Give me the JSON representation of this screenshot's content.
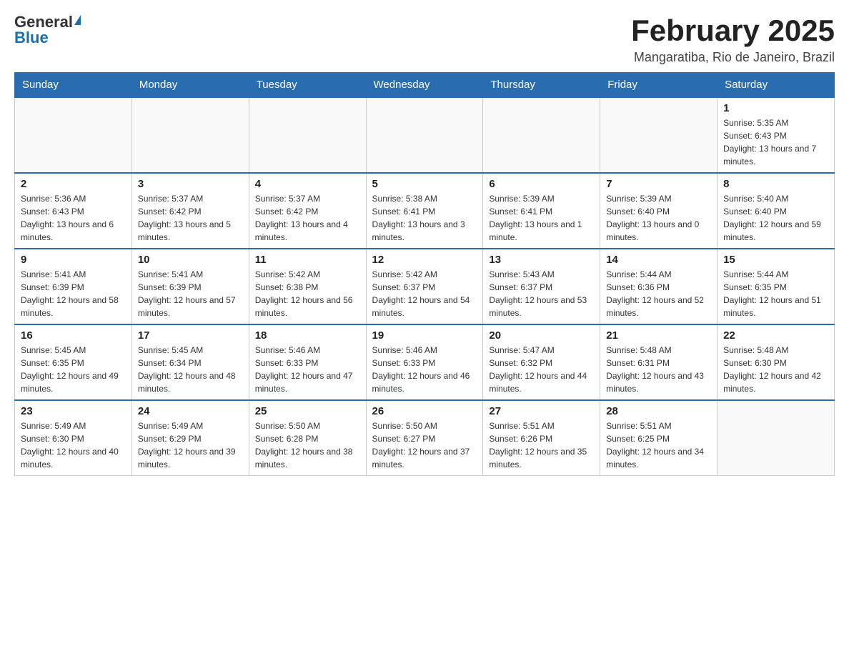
{
  "header": {
    "logo": {
      "general": "General",
      "blue": "Blue"
    },
    "title": "February 2025",
    "location": "Mangaratiba, Rio de Janeiro, Brazil"
  },
  "weekdays": [
    "Sunday",
    "Monday",
    "Tuesday",
    "Wednesday",
    "Thursday",
    "Friday",
    "Saturday"
  ],
  "weeks": [
    [
      {
        "day": "",
        "info": ""
      },
      {
        "day": "",
        "info": ""
      },
      {
        "day": "",
        "info": ""
      },
      {
        "day": "",
        "info": ""
      },
      {
        "day": "",
        "info": ""
      },
      {
        "day": "",
        "info": ""
      },
      {
        "day": "1",
        "info": "Sunrise: 5:35 AM\nSunset: 6:43 PM\nDaylight: 13 hours and 7 minutes."
      }
    ],
    [
      {
        "day": "2",
        "info": "Sunrise: 5:36 AM\nSunset: 6:43 PM\nDaylight: 13 hours and 6 minutes."
      },
      {
        "day": "3",
        "info": "Sunrise: 5:37 AM\nSunset: 6:42 PM\nDaylight: 13 hours and 5 minutes."
      },
      {
        "day": "4",
        "info": "Sunrise: 5:37 AM\nSunset: 6:42 PM\nDaylight: 13 hours and 4 minutes."
      },
      {
        "day": "5",
        "info": "Sunrise: 5:38 AM\nSunset: 6:41 PM\nDaylight: 13 hours and 3 minutes."
      },
      {
        "day": "6",
        "info": "Sunrise: 5:39 AM\nSunset: 6:41 PM\nDaylight: 13 hours and 1 minute."
      },
      {
        "day": "7",
        "info": "Sunrise: 5:39 AM\nSunset: 6:40 PM\nDaylight: 13 hours and 0 minutes."
      },
      {
        "day": "8",
        "info": "Sunrise: 5:40 AM\nSunset: 6:40 PM\nDaylight: 12 hours and 59 minutes."
      }
    ],
    [
      {
        "day": "9",
        "info": "Sunrise: 5:41 AM\nSunset: 6:39 PM\nDaylight: 12 hours and 58 minutes."
      },
      {
        "day": "10",
        "info": "Sunrise: 5:41 AM\nSunset: 6:39 PM\nDaylight: 12 hours and 57 minutes."
      },
      {
        "day": "11",
        "info": "Sunrise: 5:42 AM\nSunset: 6:38 PM\nDaylight: 12 hours and 56 minutes."
      },
      {
        "day": "12",
        "info": "Sunrise: 5:42 AM\nSunset: 6:37 PM\nDaylight: 12 hours and 54 minutes."
      },
      {
        "day": "13",
        "info": "Sunrise: 5:43 AM\nSunset: 6:37 PM\nDaylight: 12 hours and 53 minutes."
      },
      {
        "day": "14",
        "info": "Sunrise: 5:44 AM\nSunset: 6:36 PM\nDaylight: 12 hours and 52 minutes."
      },
      {
        "day": "15",
        "info": "Sunrise: 5:44 AM\nSunset: 6:35 PM\nDaylight: 12 hours and 51 minutes."
      }
    ],
    [
      {
        "day": "16",
        "info": "Sunrise: 5:45 AM\nSunset: 6:35 PM\nDaylight: 12 hours and 49 minutes."
      },
      {
        "day": "17",
        "info": "Sunrise: 5:45 AM\nSunset: 6:34 PM\nDaylight: 12 hours and 48 minutes."
      },
      {
        "day": "18",
        "info": "Sunrise: 5:46 AM\nSunset: 6:33 PM\nDaylight: 12 hours and 47 minutes."
      },
      {
        "day": "19",
        "info": "Sunrise: 5:46 AM\nSunset: 6:33 PM\nDaylight: 12 hours and 46 minutes."
      },
      {
        "day": "20",
        "info": "Sunrise: 5:47 AM\nSunset: 6:32 PM\nDaylight: 12 hours and 44 minutes."
      },
      {
        "day": "21",
        "info": "Sunrise: 5:48 AM\nSunset: 6:31 PM\nDaylight: 12 hours and 43 minutes."
      },
      {
        "day": "22",
        "info": "Sunrise: 5:48 AM\nSunset: 6:30 PM\nDaylight: 12 hours and 42 minutes."
      }
    ],
    [
      {
        "day": "23",
        "info": "Sunrise: 5:49 AM\nSunset: 6:30 PM\nDaylight: 12 hours and 40 minutes."
      },
      {
        "day": "24",
        "info": "Sunrise: 5:49 AM\nSunset: 6:29 PM\nDaylight: 12 hours and 39 minutes."
      },
      {
        "day": "25",
        "info": "Sunrise: 5:50 AM\nSunset: 6:28 PM\nDaylight: 12 hours and 38 minutes."
      },
      {
        "day": "26",
        "info": "Sunrise: 5:50 AM\nSunset: 6:27 PM\nDaylight: 12 hours and 37 minutes."
      },
      {
        "day": "27",
        "info": "Sunrise: 5:51 AM\nSunset: 6:26 PM\nDaylight: 12 hours and 35 minutes."
      },
      {
        "day": "28",
        "info": "Sunrise: 5:51 AM\nSunset: 6:25 PM\nDaylight: 12 hours and 34 minutes."
      },
      {
        "day": "",
        "info": ""
      }
    ]
  ]
}
